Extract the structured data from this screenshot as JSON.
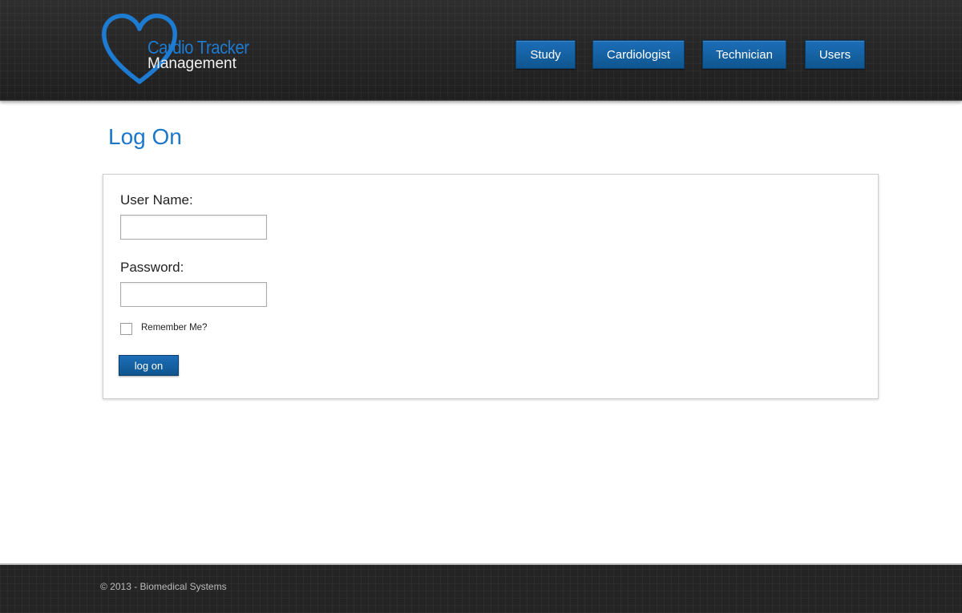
{
  "brand": {
    "title": "Cardio Tracker",
    "subtitle": "Management",
    "icon": "heart-icon",
    "accent_color": "#1e7bd2"
  },
  "nav": {
    "items": [
      {
        "label": "Study"
      },
      {
        "label": "Cardiologist"
      },
      {
        "label": "Technician"
      },
      {
        "label": "Users"
      }
    ]
  },
  "page": {
    "title": "Log On"
  },
  "form": {
    "username_label": "User Name:",
    "username_value": "",
    "password_label": "Password:",
    "password_value": "",
    "remember_label": "Remember Me?",
    "remember_checked": false,
    "submit_label": "log on"
  },
  "footer": {
    "copyright": "© 2013 - Biomedical Systems"
  },
  "colors": {
    "button_blue": "#1565a8",
    "header_bg": "#262626",
    "title_blue": "#1a77c9"
  }
}
